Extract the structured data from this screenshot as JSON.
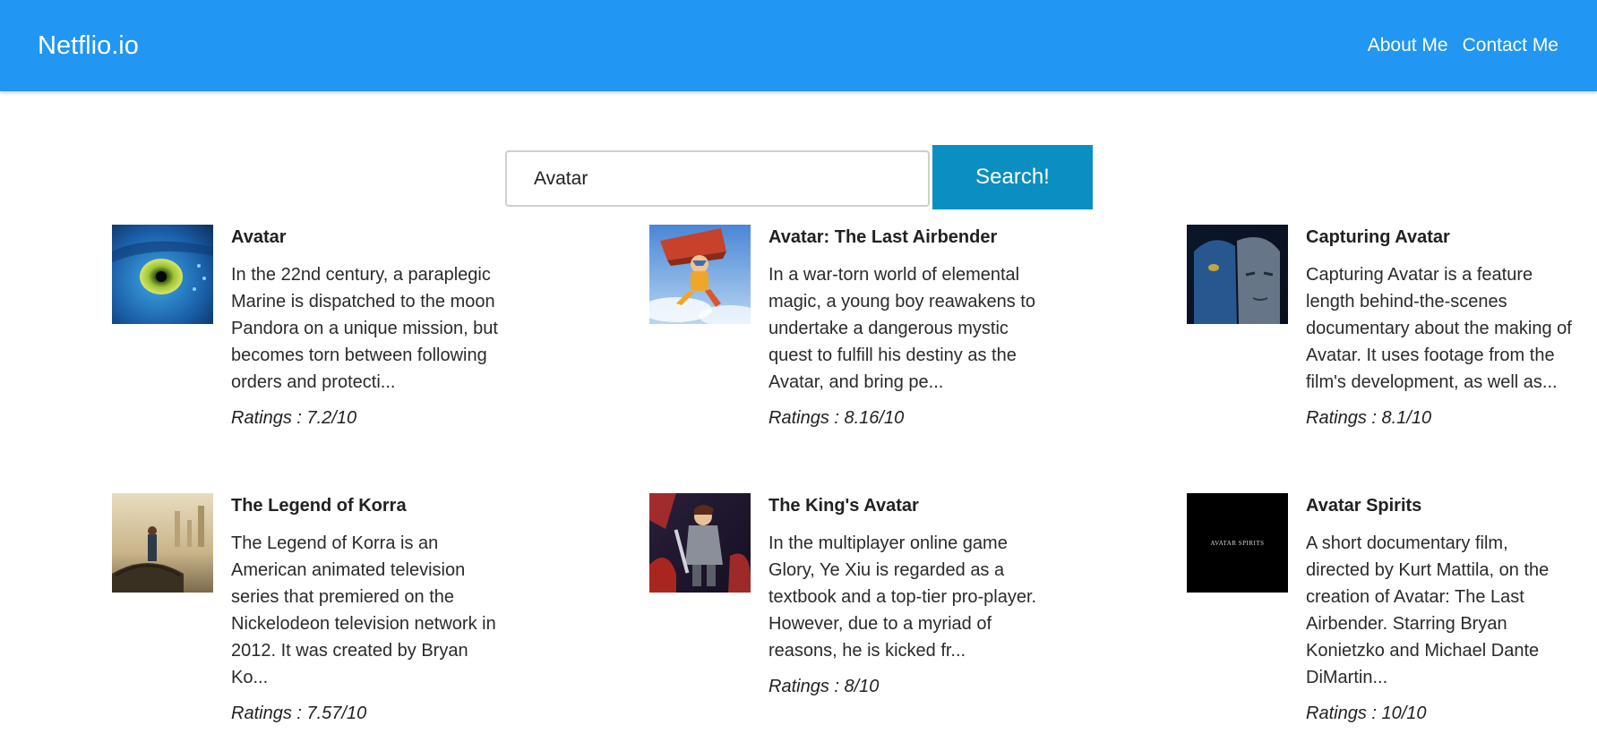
{
  "navbar": {
    "brand": "Netflio.io",
    "links": [
      {
        "label": "About Me"
      },
      {
        "label": "Contact Me"
      }
    ]
  },
  "search": {
    "value": "Avatar",
    "button_label": "Search!"
  },
  "results": [
    {
      "title": "Avatar",
      "description": "In the 22nd century, a paraplegic Marine is dispatched to the moon Pandora on a unique mission, but becomes torn between following orders and protecti...",
      "rating": "Ratings : 7.2/10"
    },
    {
      "title": "Avatar: The Last Airbender",
      "description": "In a war-torn world of elemental magic, a young boy reawakens to undertake a dangerous mystic quest to fulfill his destiny as the Avatar, and bring pe...",
      "rating": "Ratings : 8.16/10"
    },
    {
      "title": "Capturing Avatar",
      "description": "Capturing Avatar is a feature length behind-the-scenes documentary about the making of Avatar. It uses footage from the film's development, as well as...",
      "rating": "Ratings : 8.1/10"
    },
    {
      "title": "The Legend of Korra",
      "description": "The Legend of Korra is an American animated television series that premiered on the Nickelodeon television network in 2012. It was created by Bryan Ko...",
      "rating": "Ratings : 7.57/10"
    },
    {
      "title": "The King's Avatar",
      "description": "In the multiplayer online game Glory, Ye Xiu is regarded as a textbook and a top-tier pro-player. However, due to a myriad of reasons, he is kicked fr...",
      "rating": "Ratings : 8/10"
    },
    {
      "title": "Avatar Spirits",
      "description": "A short documentary film, directed by Kurt Mattila, on the creation of Avatar: The Last Airbender. Starring Bryan Konietzko and Michael Dante DiMartin...",
      "rating": "Ratings : 10/10",
      "poster_text": "AVATAR SPIRITS"
    }
  ],
  "colors": {
    "navbar": "#2196f3",
    "search_button": "#0b8ec2"
  }
}
